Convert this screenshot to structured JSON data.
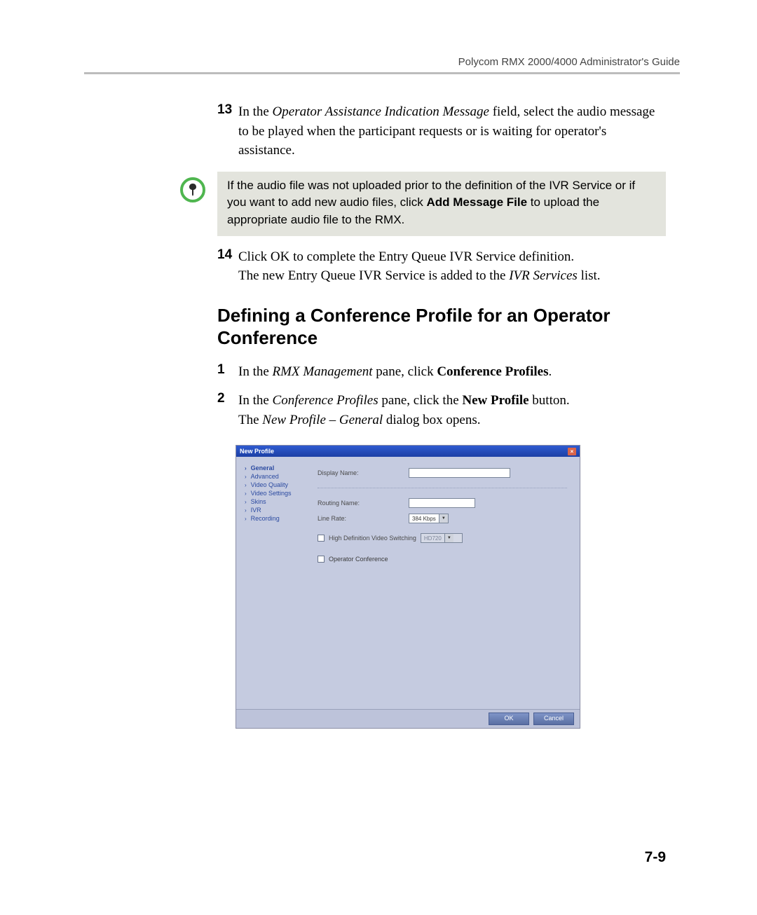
{
  "header": {
    "doc_title": "Polycom RMX 2000/4000 Administrator's Guide"
  },
  "steps": {
    "s13": {
      "num": "13",
      "part1": "In the ",
      "field_name": "Operator Assistance Indication Message",
      "part2": " field, select the audio message to be played when the participant requests or is waiting for operator's assistance."
    },
    "note": {
      "part1": "If the audio file was not uploaded prior to the definition of the IVR Service or if you want to add new audio files, click ",
      "bold": "Add Message File",
      "part2": " to upload the appropriate audio file to the RMX."
    },
    "s14": {
      "num": "14",
      "line1": "Click OK to complete the Entry Queue IVR Service definition.",
      "line2a": "The new Entry Queue IVR Service is added to the ",
      "line2_italic": "IVR Services",
      "line2b": " list."
    }
  },
  "section": {
    "heading": "Defining a Conference Profile for an Operator Conference",
    "s1": {
      "num": "1",
      "part1": "In the ",
      "italic": "RMX Management",
      "part2": " pane, click ",
      "bold": "Conference Profiles",
      "part3": "."
    },
    "s2": {
      "num": "2",
      "part1": "In the ",
      "italic1": "Conference Profiles",
      "part2": " pane, click the ",
      "bold": "New Profile",
      "part3": " button.",
      "line2a": "The ",
      "line2_italic": "New Profile – General",
      "line2b": " dialog box opens."
    }
  },
  "dialog": {
    "title": "New Profile",
    "close": "×",
    "sidebar": {
      "items": [
        {
          "label": "General",
          "selected": true
        },
        {
          "label": "Advanced",
          "selected": false
        },
        {
          "label": "Video Quality",
          "selected": false
        },
        {
          "label": "Video Settings",
          "selected": false
        },
        {
          "label": "Skins",
          "selected": false
        },
        {
          "label": "IVR",
          "selected": false
        },
        {
          "label": "Recording",
          "selected": false
        }
      ]
    },
    "form": {
      "display_name_label": "Display Name:",
      "display_name_value": "",
      "routing_name_label": "Routing Name:",
      "routing_name_value": "",
      "line_rate_label": "Line Rate:",
      "line_rate_value": "384 Kbps",
      "hd_switch_label": "High Definition Video Switching",
      "hd_switch_value": "HD720",
      "op_conf_label": "Operator Conference"
    },
    "buttons": {
      "ok": "OK",
      "cancel": "Cancel"
    }
  },
  "page_number": "7-9"
}
